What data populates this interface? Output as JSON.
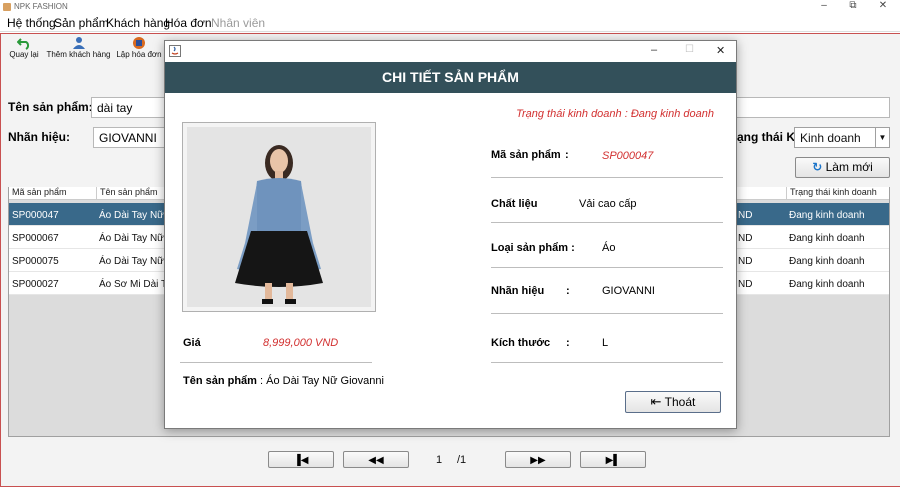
{
  "window": {
    "title": "NPK FASHION",
    "controls": {
      "minimize": "–",
      "maximize": "⧉",
      "close": "✕"
    }
  },
  "menu": {
    "items": [
      "Hệ thống",
      "Sản phẩm",
      "Khách hàng",
      "Hóa đơn",
      "Nhân viên"
    ]
  },
  "toolbar": {
    "back_label": "Quay lại",
    "add_customer_label": "Thêm khách hàng",
    "create_invoice_label": "Lập hóa đơn"
  },
  "search": {
    "product_name_label": "Tên sản phẩm:",
    "product_name_value": "dài tay",
    "brand_label": "Nhãn hiệu:",
    "brand_value": "GIOVANNI",
    "status_label": "ạng thái KD",
    "status_value": "Kinh doanh",
    "refresh_label": "Làm mới"
  },
  "table": {
    "headers": {
      "code": "Mã sản phẩm",
      "name": "Tên sản phẩm",
      "status": "Trạng thái kinh doanh"
    },
    "rows": [
      {
        "code": "SP000047",
        "name": "Áo Dài Tay Nữ G",
        "mid": "ND",
        "status": "Đang kinh doanh",
        "selected": true
      },
      {
        "code": "SP000067",
        "name": "Áo Dài Tay Nữ G",
        "mid": "ND",
        "status": "Đang kinh doanh",
        "selected": false
      },
      {
        "code": "SP000075",
        "name": "Áo Dài Tay Nữ G",
        "mid": "ND",
        "status": "Đang kinh doanh",
        "selected": false
      },
      {
        "code": "SP000027",
        "name": "Áo Sơ Mi Dài Tay",
        "mid": "ND",
        "status": "Đang kinh doanh",
        "selected": false
      }
    ]
  },
  "pagination": {
    "current": "1",
    "total": "/1"
  },
  "dialog": {
    "title": "CHI TIẾT SẢN PHẨM",
    "status_text": "Trạng thái kinh doanh :  Đang kinh doanh",
    "code_label": "Mã sản phẩm",
    "code_colon": ":",
    "code_value": "SP000047",
    "material_label": "Chất liệu",
    "material_value": "Vải cao cấp",
    "type_label": "Loại sản phẩm :",
    "type_value": "Áo",
    "brand_label": "Nhãn hiệu",
    "brand_colon": ":",
    "brand_value": "GIOVANNI",
    "size_label": "Kích thước",
    "size_colon": ":",
    "size_value": "L",
    "price_label": "Giá",
    "price_value": "8,999,000 VND",
    "name_label": "Tên sản phẩm",
    "name_value": ": Áo Dài Tay Nữ Giovanni",
    "exit_label": "Thoát",
    "controls": {
      "minimize": "–",
      "maximize": "☐",
      "close": "✕"
    }
  },
  "colors": {
    "header_bg": "#33505a",
    "selected_row": "#39698a",
    "accent_red": "#d23030"
  }
}
